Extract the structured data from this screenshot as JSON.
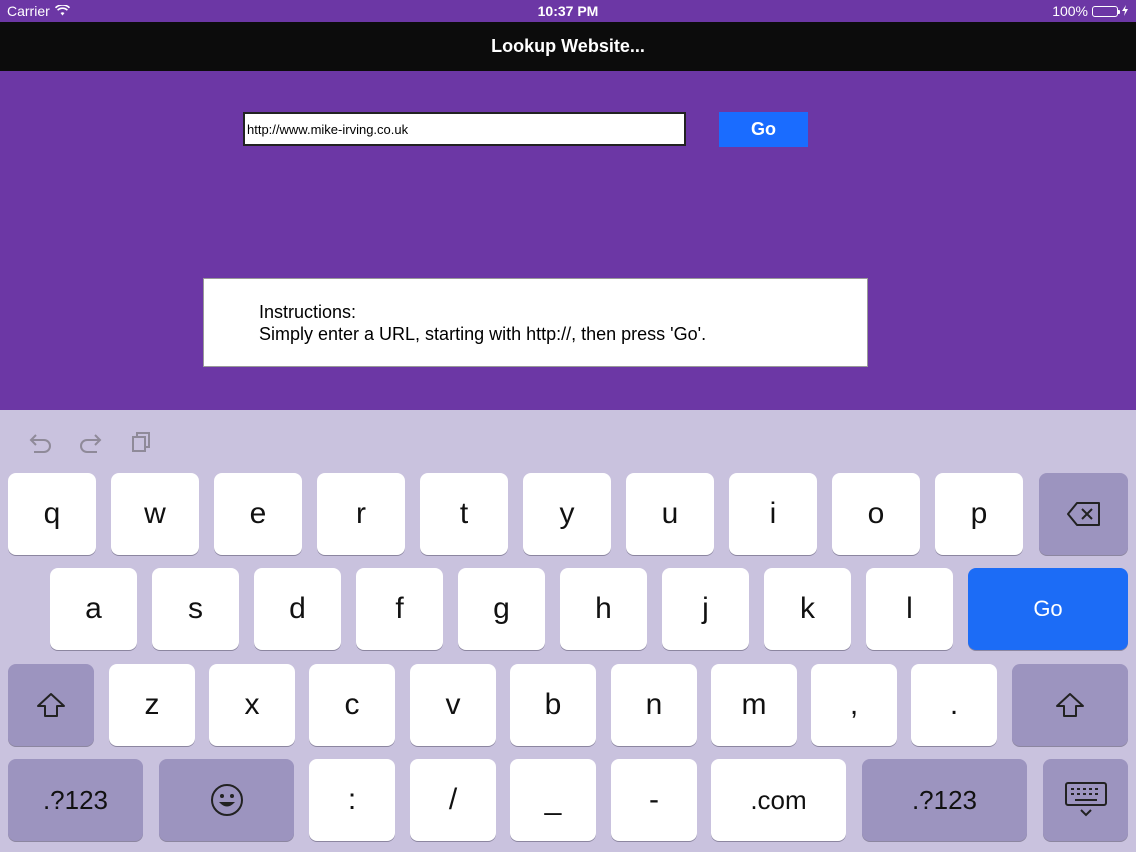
{
  "status_bar": {
    "carrier": "Carrier",
    "time": "10:37 PM",
    "battery_percent": "100%",
    "battery_level": 1.0
  },
  "nav": {
    "title": "Lookup Website..."
  },
  "url_input": {
    "value": "http://www.mike-irving.co.uk"
  },
  "go_button": {
    "label": "Go"
  },
  "instructions": {
    "heading": "Instructions:",
    "text": "Simply enter a URL, starting with http://, then press 'Go'."
  },
  "keyboard": {
    "toolbar_icons": [
      "undo-icon",
      "redo-icon",
      "paste-icon"
    ],
    "row1": [
      "q",
      "w",
      "e",
      "r",
      "t",
      "y",
      "u",
      "i",
      "o",
      "p"
    ],
    "row2": [
      "a",
      "s",
      "d",
      "f",
      "g",
      "h",
      "j",
      "k",
      "l"
    ],
    "row3": [
      "z",
      "x",
      "c",
      "v",
      "b",
      "n",
      "m",
      ",",
      "."
    ],
    "row4": [
      ".?123",
      ":",
      "/",
      "_",
      "-",
      ".com",
      ".?123"
    ],
    "go_label": "Go",
    "icons": {
      "backspace": "backspace-icon",
      "shift": "shift-icon",
      "emoji": "emoji-icon",
      "dismiss": "keyboard-dismiss-icon"
    }
  },
  "colors": {
    "background": "#6c37a5",
    "accent": "#1a6cff",
    "keyboard": "#c9c2de"
  }
}
